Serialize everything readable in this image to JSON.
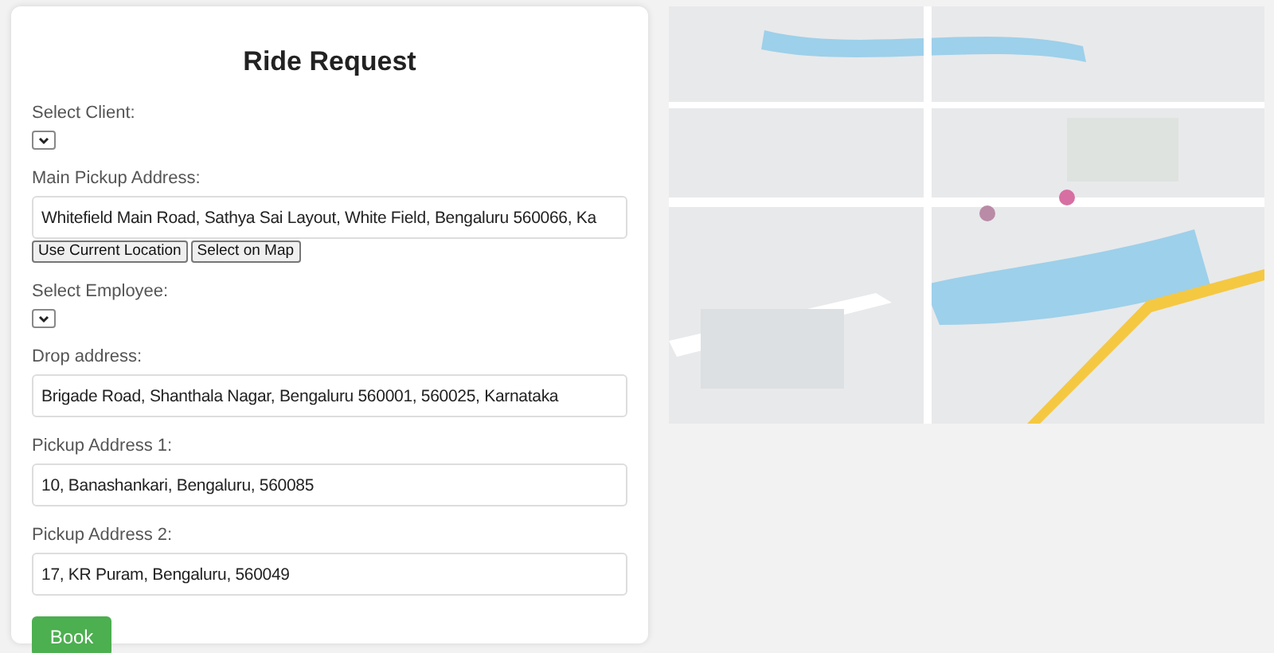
{
  "form": {
    "title": "Ride Request",
    "fields": [
      {
        "kind": "select",
        "label": "Select Client:"
      },
      {
        "kind": "text",
        "label": "Main Pickup Address:",
        "value": "Whitefield Main Road, Sathya Sai Layout, White Field, Bengaluru 560066, Ka",
        "buttons": [
          "Use Current Location",
          "Select on Map"
        ]
      },
      {
        "kind": "select",
        "label": "Select Employee:"
      },
      {
        "kind": "text",
        "label": "Drop address:",
        "value": "Brigade Road, Shanthala Nagar, Bengaluru 560001, 560025, Karnataka"
      },
      {
        "kind": "text",
        "label": "Pickup Address 1:",
        "value": "10, Banashankari, Bengaluru, 560085"
      },
      {
        "kind": "text",
        "label": "Pickup Address 2:",
        "value": "17, KR Puram, Bengaluru, 560049"
      }
    ],
    "submit": "Book"
  }
}
